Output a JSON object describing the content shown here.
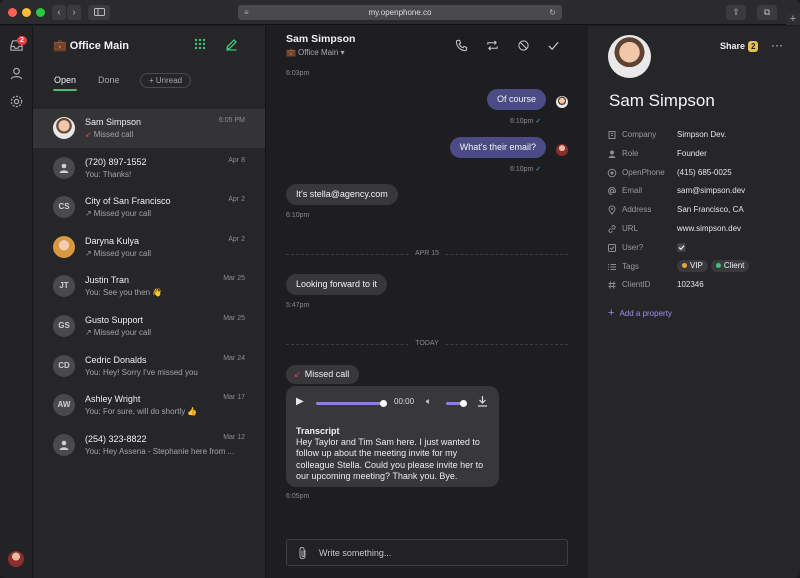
{
  "browser": {
    "url": "my.openphone.co",
    "traffic_colors": [
      "#ff5f57",
      "#febc2e",
      "#28c840"
    ]
  },
  "rail": {
    "inbox_badge": "2"
  },
  "inbox": {
    "icon": "briefcase-icon",
    "title": "Office Main",
    "tabs": {
      "open": "Open",
      "done": "Done",
      "unread": "+ Unread"
    }
  },
  "conversations": [
    {
      "name": "Sam Simpson",
      "preview": "Missed call",
      "date": "6:05 PM",
      "avatar": "photo",
      "arrow": "missed"
    },
    {
      "name": "(720) 897-1552",
      "preview": "You: Thanks!",
      "date": "Apr 8",
      "avatar": "person",
      "arrow": ""
    },
    {
      "name": "City of San Francisco",
      "preview": "Missed your call",
      "date": "Apr 2",
      "avatar": "CS",
      "arrow": "outgoing"
    },
    {
      "name": "Daryna Kulya",
      "preview": "Missed your call",
      "date": "Apr 2",
      "avatar": "photo",
      "arrow": "outgoing"
    },
    {
      "name": "Justin Tran",
      "preview": "You: See you then 👋",
      "date": "Mar 25",
      "avatar": "JT",
      "arrow": ""
    },
    {
      "name": "Gusto Support",
      "preview": "Missed your call",
      "date": "Mar 25",
      "avatar": "GS",
      "arrow": "outgoing"
    },
    {
      "name": "Cedric Donalds",
      "preview": "You: Hey! Sorry I've missed you",
      "date": "Mar 24",
      "avatar": "CD",
      "arrow": ""
    },
    {
      "name": "Ashley Wright",
      "preview": "You: For sure, will do shortly 👍",
      "date": "Mar 17",
      "avatar": "AW",
      "arrow": ""
    },
    {
      "name": "(254) 323-8822",
      "preview": "You: Hey Assena - Stephanie here from ...",
      "date": "Mar 12",
      "avatar": "person",
      "arrow": ""
    }
  ],
  "chat": {
    "contact": "Sam Simpson",
    "inbox": "Office Main",
    "first_time": "6:03pm",
    "messages": [
      {
        "dir": "out",
        "text": "Of course",
        "time": "6:10pm"
      },
      {
        "dir": "out",
        "text": "What's their email?",
        "time": "6:10pm"
      },
      {
        "dir": "in",
        "text": "It's stella@agency.com",
        "time": "6:10pm"
      },
      {
        "dir": "in",
        "text": "Looking forward to it",
        "time": "5:47pm"
      }
    ],
    "divider1": "APR 15",
    "divider2": "TODAY",
    "missed_call": "Missed call",
    "audio_time": "00:00",
    "transcript_title": "Transcript",
    "transcript": "Hey Taylor and Tim Sam here. I just wanted to follow up about the meeting invite for my colleague Stella. Could you please invite her to our upcoming meeting? Thank you. Bye.",
    "call_time": "6:05pm",
    "composer_placeholder": "Write something...",
    "audio_progress": 1.0,
    "volume": 1.0
  },
  "details": {
    "name": "Sam Simpson",
    "share_label": "Share",
    "share_count": "2",
    "properties": [
      {
        "label": "Company",
        "value": "Simpson Dev.",
        "icon": "building-icon"
      },
      {
        "label": "Role",
        "value": "Founder",
        "icon": "person-icon"
      },
      {
        "label": "OpenPhone",
        "value": "(415) 685-0025",
        "icon": "phone-icon"
      },
      {
        "label": "Email",
        "value": "sam@simpson.dev",
        "icon": "at-icon"
      },
      {
        "label": "Address",
        "value": "San Francisco, CA",
        "icon": "pin-icon"
      },
      {
        "label": "URL",
        "value": "www.simpson.dev",
        "icon": "link-icon"
      },
      {
        "label": "User?",
        "value": "",
        "icon": "checkbox-icon"
      },
      {
        "label": "Tags",
        "value": "",
        "icon": "list-icon"
      },
      {
        "label": "ClientID",
        "value": "102346",
        "icon": "hash-icon"
      }
    ],
    "tags": [
      {
        "label": "VIP",
        "color": "#f0a23a"
      },
      {
        "label": "Client",
        "color": "#3ec27a"
      }
    ],
    "add_property": "Add a property"
  },
  "colors": {
    "accent_green": "#3ec27a",
    "outgoing_bubble": "#4b4c86",
    "link_purple": "#9d8ff0"
  }
}
